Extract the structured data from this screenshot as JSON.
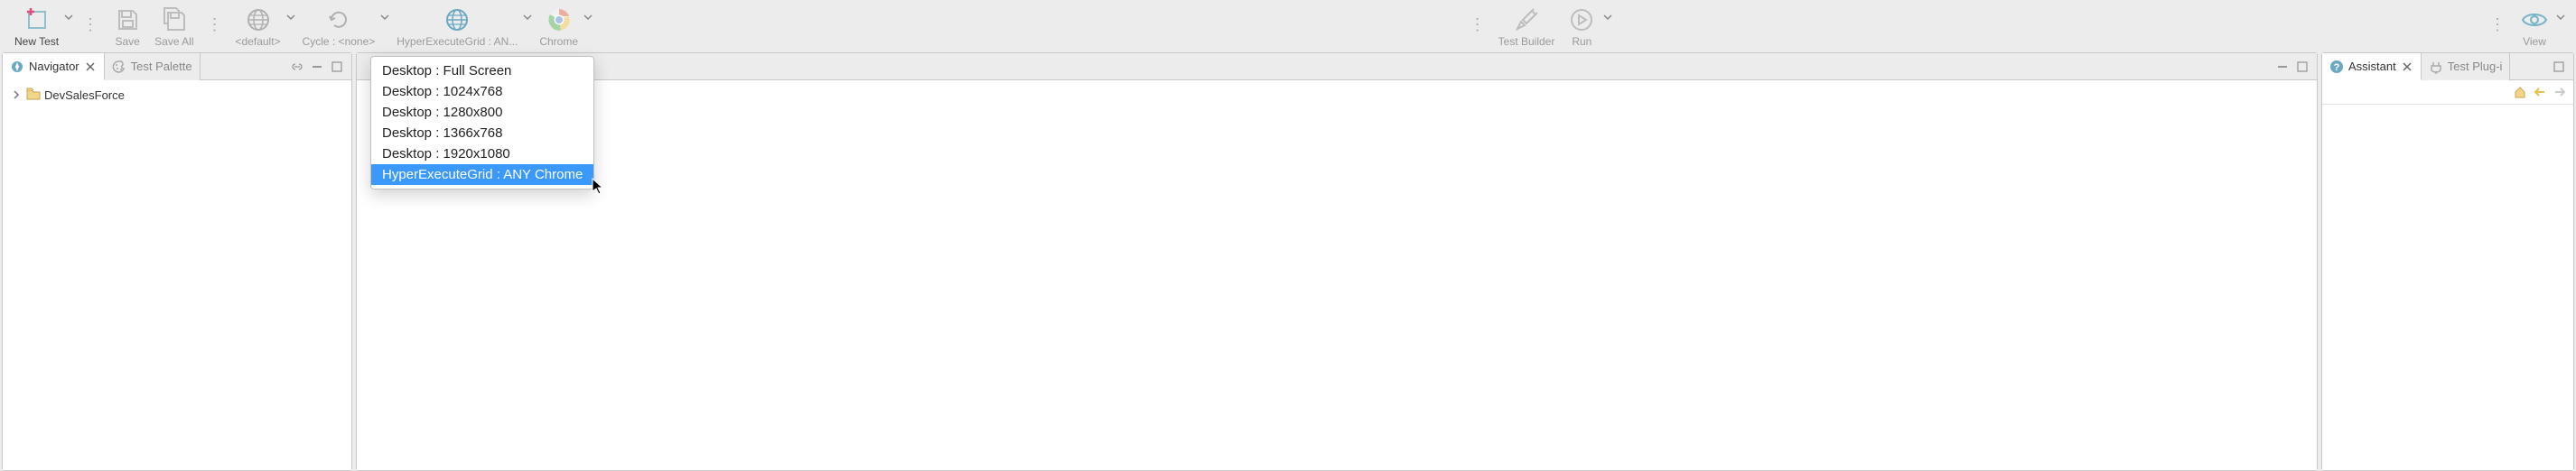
{
  "toolbar": {
    "new_test": "New Test",
    "save": "Save",
    "save_all": "Save All",
    "default": "<default>",
    "cycle": "Cycle : <none>",
    "grid": "HyperExecuteGrid : AN...",
    "chrome": "Chrome",
    "test_builder": "Test Builder",
    "run": "Run",
    "view": "View"
  },
  "navigator": {
    "tab_label": "Navigator",
    "palette_tab": "Test Palette",
    "tree": {
      "root": "DevSalesForce"
    }
  },
  "assistant": {
    "tab_label": "Assistant",
    "plugin_tab": "Test Plug-i"
  },
  "dropdown": {
    "items": [
      "Desktop : Full Screen",
      "Desktop : 1024x768",
      "Desktop : 1280x800",
      "Desktop : 1366x768",
      "Desktop : 1920x1080",
      "HyperExecuteGrid : ANY Chrome"
    ],
    "selected_index": 5
  }
}
